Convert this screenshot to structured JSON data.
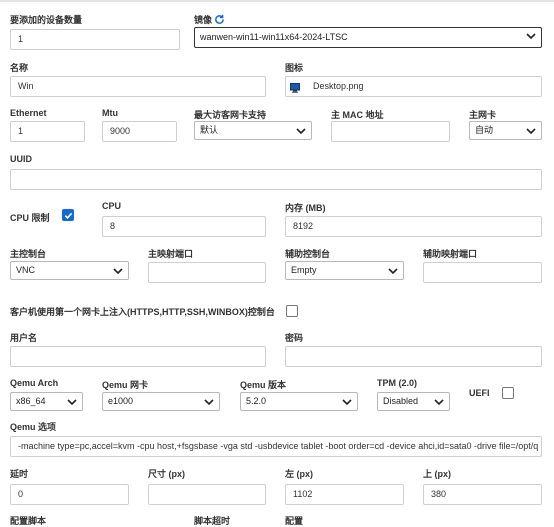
{
  "form": {
    "device_count_label": "要添加的设备数量",
    "device_count_value": "1",
    "image_label": "镜像",
    "image_value": "wanwen-win11-win11x64-2024-LTSC",
    "name_label": "名称",
    "name_value": "Win",
    "icon_label": "图标",
    "icon_value": "Desktop.png",
    "ethernet_label": "Ethernet",
    "ethernet_value": "1",
    "mtu_label": "Mtu",
    "mtu_value": "9000",
    "max_guest_nic_label": "最大访客网卡支持",
    "max_guest_nic_value": "默认",
    "main_mac_label": "主 MAC 地址",
    "main_mac_value": "",
    "main_nic_label": "主网卡",
    "main_nic_value": "自动",
    "uuid_label": "UUID",
    "uuid_value": "",
    "cpu_limit_label": "CPU 限制",
    "cpu_limit_checked": true,
    "cpu_label": "CPU",
    "cpu_value": "8",
    "memory_label": "内存 (MB)",
    "memory_value": "8192",
    "main_console_label": "主控制台",
    "main_console_value": "VNC",
    "main_map_port_label": "主映射端口",
    "main_map_port_value": "",
    "aux_console_label": "辅助控制台",
    "aux_console_value": "Empty",
    "aux_map_port_label": "辅助映射端口",
    "aux_map_port_value": "",
    "inject_label": "客户机使用第一个网卡上注入(HTTPS,HTTP,SSH,WINBOX)控制台",
    "inject_checked": false,
    "username_label": "用户名",
    "username_value": "",
    "password_label": "密码",
    "password_value": "",
    "qemu_arch_label": "Qemu Arch",
    "qemu_arch_value": "x86_64",
    "qemu_nic_label": "Qemu 网卡",
    "qemu_nic_value": "e1000",
    "qemu_version_label": "Qemu 版本",
    "qemu_version_value": "5.2.0",
    "tpm_label": "TPM (2.0)",
    "tpm_value": "Disabled",
    "uefi_label": "UEFI",
    "uefi_checked": false,
    "qemu_options_label": "Qemu 选项",
    "qemu_options_value": "-machine type=pc,accel=kvm -cpu host,+fsgsbase -vga std -usbdevice tablet -boot order=cd -device ahci,id=sata0 -drive file=/opt/q",
    "delay_label": "延时",
    "delay_value": "0",
    "size_label": "尺寸 (px)",
    "size_value": "",
    "left_label": "左 (px)",
    "left_value": "1102",
    "top_label": "上 (px)",
    "top_value": "380",
    "bottom_label_1": "配置脚本",
    "bottom_label_2": "脚本超时",
    "bottom_label_3": "配置"
  },
  "icons": {
    "refresh": "refresh-icon",
    "desktop": "desktop-icon",
    "chevron": "chevron-down-icon",
    "check": "check-icon"
  },
  "colors": {
    "accent": "#0f6bd6",
    "label": "#333333",
    "border": "#cfcfcf"
  }
}
